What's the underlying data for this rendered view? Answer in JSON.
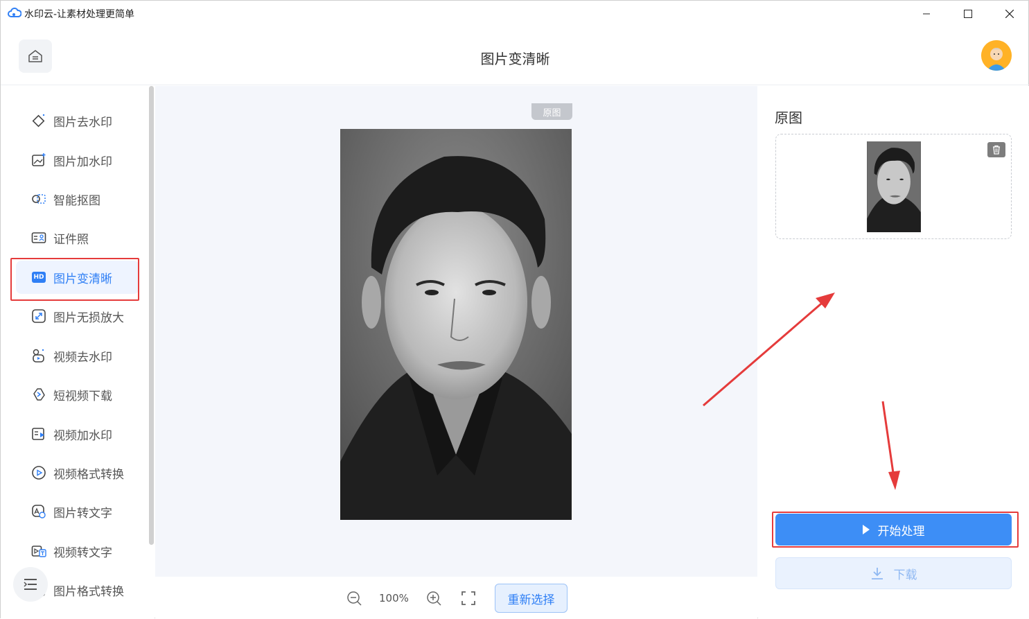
{
  "window": {
    "title": "水印云-让素材处理更简单"
  },
  "header": {
    "page_title": "图片变清晰"
  },
  "sidebar": {
    "items": [
      {
        "label": "图片去水印",
        "icon": "eraser-icon"
      },
      {
        "label": "图片加水印",
        "icon": "image-add-icon"
      },
      {
        "label": "智能抠图",
        "icon": "cutout-icon"
      },
      {
        "label": "证件照",
        "icon": "id-card-icon"
      },
      {
        "label": "图片变清晰",
        "icon": "hd-icon",
        "badge": "HD",
        "active": true
      },
      {
        "label": "图片无损放大",
        "icon": "enlarge-icon"
      },
      {
        "label": "视频去水印",
        "icon": "video-eraser-icon"
      },
      {
        "label": "短视频下载",
        "icon": "link-download-icon"
      },
      {
        "label": "视频加水印",
        "icon": "video-add-icon"
      },
      {
        "label": "视频格式转换",
        "icon": "play-circle-icon"
      },
      {
        "label": "图片转文字",
        "icon": "image-text-icon"
      },
      {
        "label": "视频转文字",
        "icon": "video-text-icon"
      },
      {
        "label": "图片格式转换",
        "icon": "image-format-icon"
      }
    ]
  },
  "canvas": {
    "tag": "原图"
  },
  "toolbar": {
    "zoom": "100%",
    "reselect_label": "重新选择"
  },
  "right_panel": {
    "title": "原图",
    "start_label": "开始处理",
    "download_label": "下载"
  },
  "colors": {
    "accent": "#2f7ff5",
    "primary_button": "#3d8ef6",
    "highlight": "#e53b3b"
  }
}
